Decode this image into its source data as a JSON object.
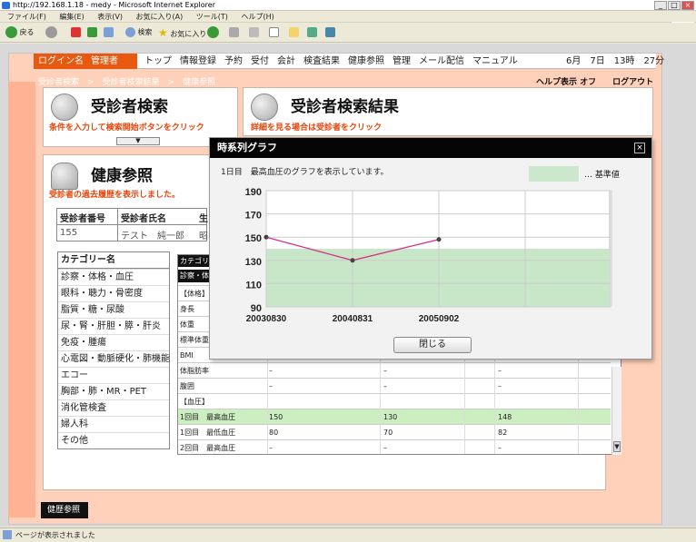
{
  "browser": {
    "title": "http://192.168.1.18 - medy - Microsoft Internet Explorer",
    "menus": [
      "ファイル(F)",
      "編集(E)",
      "表示(V)",
      "お気に入り(A)",
      "ツール(T)",
      "ヘルプ(H)"
    ],
    "toolbar": {
      "back": "戻る",
      "search": "検索",
      "favorites": "お気に入り"
    },
    "status": "ページが表示されました"
  },
  "nav": {
    "login_label": "ログイン名",
    "login_user": "管理者",
    "items": [
      "トップ",
      "情報登録",
      "予約",
      "受付",
      "会計",
      "検査結果",
      "健康参照",
      "管理",
      "メール配信",
      "マニュアル"
    ],
    "datetime": "6月　7日　13時　27分",
    "breadcrumb": "受診者検索　>　受診者検索結果　>　健康参照",
    "help": "ヘルプ表示 オフ　　ログアウト"
  },
  "panels": {
    "search": {
      "title": "受診者検索",
      "subtitle": "条件を入力して検索開始ボタンをクリック"
    },
    "results": {
      "title": "受診者検索結果",
      "subtitle": "詳細を見る場合は受診者をクリック"
    },
    "history": {
      "title": "健康参照",
      "subtitle": "受診者の過去履歴を表示しました。"
    }
  },
  "patient": {
    "headers": [
      "受診者番号",
      "受診者氏名",
      "生"
    ],
    "values": [
      "155",
      "テスト　純一郎",
      "昭"
    ]
  },
  "categories": {
    "header": "カテゴリー名",
    "items": [
      "診察・体格・血圧",
      "眼科・聴力・骨密度",
      "脂質・糖・尿酸",
      "尿・腎・肝胆・膵・肝炎",
      "免疫・腫瘍",
      "心電図・動脈硬化・肺機能",
      "エコー",
      "胸部・肺・MR・PET",
      "消化管検査",
      "婦人科",
      "その他"
    ]
  },
  "datatable": {
    "tab": "カテゴリー",
    "tab2": "診察・体格",
    "rows": [
      {
        "label": "【体格】",
        "v": [
          "",
          "",
          ""
        ]
      },
      {
        "label": "身長",
        "v": [
          "",
          "",
          ""
        ]
      },
      {
        "label": "体重",
        "v": [
          "",
          "",
          ""
        ]
      },
      {
        "label": "標準体重",
        "v": [
          "",
          "",
          ""
        ]
      },
      {
        "label": "BMI",
        "v": [
          "",
          "",
          ""
        ]
      },
      {
        "label": "体脂肪率",
        "v": [
          "–",
          "–",
          "–"
        ]
      },
      {
        "label": "腹囲",
        "v": [
          "–",
          "–",
          "–"
        ]
      },
      {
        "label": "【血圧】",
        "v": [
          "",
          "",
          ""
        ]
      },
      {
        "label": "1回目　最高血圧",
        "v": [
          "150",
          "130",
          "148"
        ],
        "hl": true
      },
      {
        "label": "1回目　最低血圧",
        "v": [
          "80",
          "70",
          "82"
        ]
      },
      {
        "label": "2回目　最高血圧",
        "v": [
          "–",
          "–",
          "–"
        ]
      }
    ]
  },
  "bottom_nav": "健歴参照",
  "dialog": {
    "title": "時系列グラフ",
    "close_icon": "×",
    "message": "1日目　最高血圧のグラフを表示しています。",
    "legend": "… 基準値",
    "close_button": "閉じる"
  },
  "chart_data": {
    "type": "line",
    "categories": [
      "20030830",
      "20040831",
      "20050902"
    ],
    "series": [
      {
        "values": [
          150,
          130,
          148
        ]
      }
    ],
    "reference_band": [
      90,
      140
    ],
    "ylim": [
      90,
      190
    ],
    "yticks": [
      190,
      170,
      150,
      130,
      110,
      90
    ],
    "line_color": "#d6338a",
    "band_color": "#c8e6c8",
    "grid": true
  }
}
